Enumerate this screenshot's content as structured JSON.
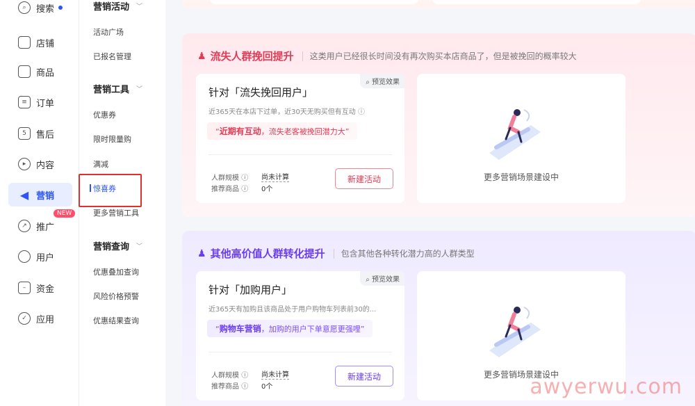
{
  "nav": {
    "items": [
      {
        "label": "搜索",
        "icon": "search-icon"
      },
      {
        "label": "店铺",
        "icon": "store-icon"
      },
      {
        "label": "商品",
        "icon": "product-icon"
      },
      {
        "label": "订单",
        "icon": "order-icon"
      },
      {
        "label": "售后",
        "icon": "aftersale-icon"
      },
      {
        "label": "内容",
        "icon": "content-icon"
      },
      {
        "label": "营销",
        "icon": "megaphone-icon"
      },
      {
        "label": "推广",
        "icon": "promote-icon",
        "badge": "NEW"
      },
      {
        "label": "用户",
        "icon": "user-icon"
      },
      {
        "label": "资金",
        "icon": "wallet-icon"
      },
      {
        "label": "应用",
        "icon": "apps-icon"
      }
    ]
  },
  "submenu": {
    "groups": [
      {
        "title": "营销活动",
        "items": [
          "活动广场",
          "已报名管理"
        ]
      },
      {
        "title": "营销工具",
        "items": [
          "优惠券",
          "限时限量购",
          "满减",
          "惊喜券",
          "更多营销工具"
        ]
      },
      {
        "title": "营销查询",
        "items": [
          "优惠叠加查询",
          "风险价格预警",
          "优惠结果查询"
        ]
      }
    ]
  },
  "sections": [
    {
      "title": "流失人群挽回提升",
      "desc": "这类用户已经很长时间没有再次购买本店商品了，但是被挽回的概率较大",
      "card": {
        "preview": "预览效果",
        "title": "针对「流失挽回用户」",
        "sub": "近365天在本店下过单，近30天无购买但有互动 ⓘ",
        "tag_strong": "近期有互动",
        "tag_rest": "，流失老客被挽回潜力大",
        "scale_label": "人群规模",
        "scale_value": "尚未计算",
        "rec_label": "推荐商品",
        "rec_value": "0个",
        "button": "新建活动"
      },
      "more": "更多营销场景建设中"
    },
    {
      "title": "其他高价值人群转化提升",
      "desc": "包含其他各种转化潜力高的人群类型",
      "card": {
        "preview": "预览效果",
        "title": "针对「加购用户」",
        "sub": "近365天有加购且该商品处于用户购物车列表前30的...",
        "tag_strong": "购物车营销",
        "tag_rest": "，加购的用户下单意愿更强哩",
        "scale_label": "人群规模",
        "scale_value": "尚未计算",
        "rec_label": "推荐商品",
        "rec_value": "0个",
        "button": "新建活动"
      },
      "more": "更多营销场景建设中"
    }
  ],
  "watermark": "awyerwu.com"
}
